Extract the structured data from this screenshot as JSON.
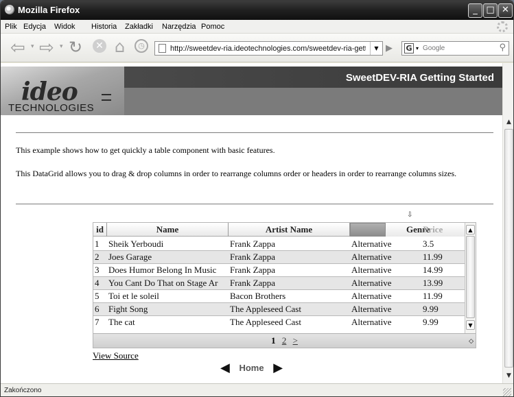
{
  "window": {
    "title": "Mozilla Firefox",
    "controls": {
      "minimize": "_",
      "maximize": "□",
      "close": "✕"
    }
  },
  "menu": [
    "Plik",
    "Edycja",
    "Widok",
    "Historia",
    "Zakładki",
    "Narzędzia",
    "Pomoc"
  ],
  "nav": {
    "url": "http://sweetdev-ria.ideotechnologies.com/sweetdev-ria-getting",
    "search_placeholder": "Google",
    "search_engine": "G",
    "icons": [
      "back-icon",
      "forward-icon",
      "reload-icon",
      "stop-icon",
      "home-icon",
      "history-icon",
      "go-icon",
      "magnifier-icon"
    ]
  },
  "banner": {
    "title": "SweetDEV-RIA Getting Started",
    "logo_mark": "ideo",
    "logo_text": "TECHNOLOGIES"
  },
  "content": {
    "intro": "This example shows how to get quickly a table component with basic features.",
    "description": "This DataGrid allows you to drag & drop columns in order to rearrange columns order or headers in order to rearrange columns sizes."
  },
  "grid": {
    "columns": [
      "id",
      "Name",
      "Artist Name",
      "Genre",
      "Price"
    ],
    "rows": [
      [
        "1",
        "Sheik Yerboudi",
        "Frank Zappa",
        "Alternative",
        "3.5"
      ],
      [
        "2",
        "Joes Garage",
        "Frank Zappa",
        "Alternative",
        "11.99"
      ],
      [
        "3",
        "Does Humor Belong In Music",
        "Frank Zappa",
        "Alternative",
        "14.99"
      ],
      [
        "4",
        "You Cant Do That on Stage Ar",
        "Frank Zappa",
        "Alternative",
        "13.99"
      ],
      [
        "5",
        "Toi et le soleil",
        "Bacon Brothers",
        "Alternative",
        "11.99"
      ],
      [
        "6",
        "Fight Song",
        "The Appleseed Cast",
        "Alternative",
        "9.99"
      ],
      [
        "7",
        "The cat",
        "The Appleseed Cast",
        "Alternative",
        "9.99"
      ]
    ],
    "pager": {
      "current": "1",
      "next_page": "2",
      "next": ">"
    },
    "drag_marker": "⇩"
  },
  "links": {
    "view_source": "View Source",
    "home": "Home"
  },
  "status": "Zakończono"
}
